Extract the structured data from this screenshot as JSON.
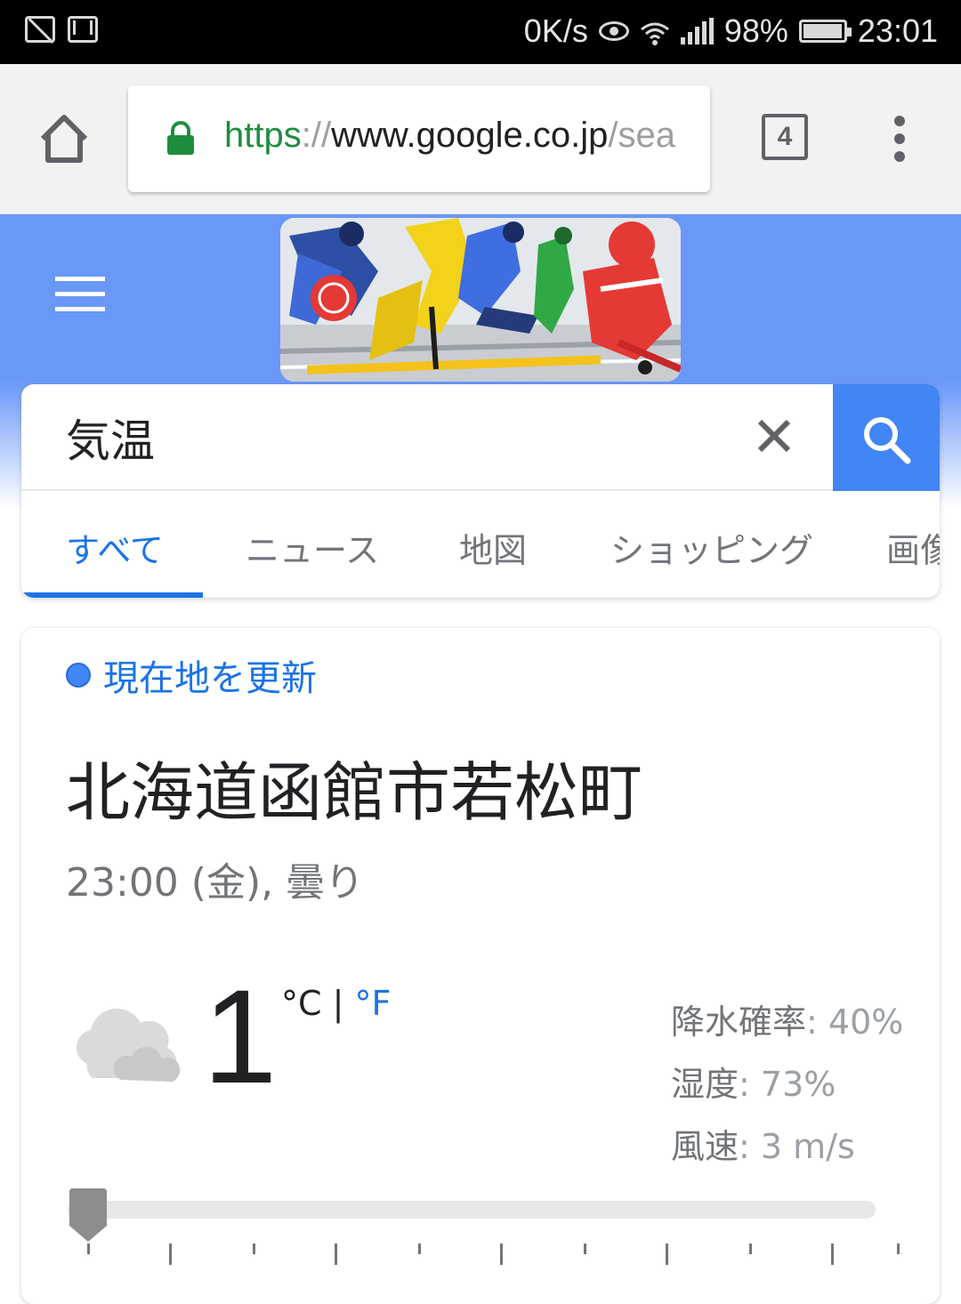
{
  "status_bar": {
    "net_speed": "0K/s",
    "battery": "98%",
    "time": "23:01",
    "icons": [
      "photo-off-icon",
      "mail-icon",
      "eye-icon",
      "wifi-icon",
      "signal-icon",
      "battery-icon"
    ]
  },
  "browser": {
    "url_scheme": "https",
    "url_sep": "://",
    "url_host": "www.google.co.jp",
    "url_path": "/sea",
    "tab_count": "4",
    "icons": [
      "home-icon",
      "lock-icon",
      "tabs-icon",
      "more-vert-icon"
    ]
  },
  "search": {
    "query": "気温",
    "tabs": [
      "すべて",
      "ニュース",
      "地図",
      "ショッピング",
      "画像"
    ],
    "active_tab": 0,
    "icons": [
      "menu-icon",
      "close-icon",
      "search-icon"
    ]
  },
  "weather": {
    "update_location": "現在地を更新",
    "location": "北海道函館市若松町",
    "time_condition": "23:00 (金), 曇り",
    "temperature": "1",
    "unit_c": "°C",
    "unit_sep": "|",
    "unit_f": "°F",
    "precip_label": "降水確率",
    "precip_value": ": 40%",
    "humidity_label": "湿度",
    "humidity_value": ": 73%",
    "wind_label": "風速",
    "wind_value": ": 3 m/s",
    "icon": "cloudy-icon"
  },
  "colors": {
    "accent": "#1a73e8",
    "search_button": "#4285f4",
    "header_blue": "#6a98f9",
    "secure_green": "#1e8e3e"
  }
}
